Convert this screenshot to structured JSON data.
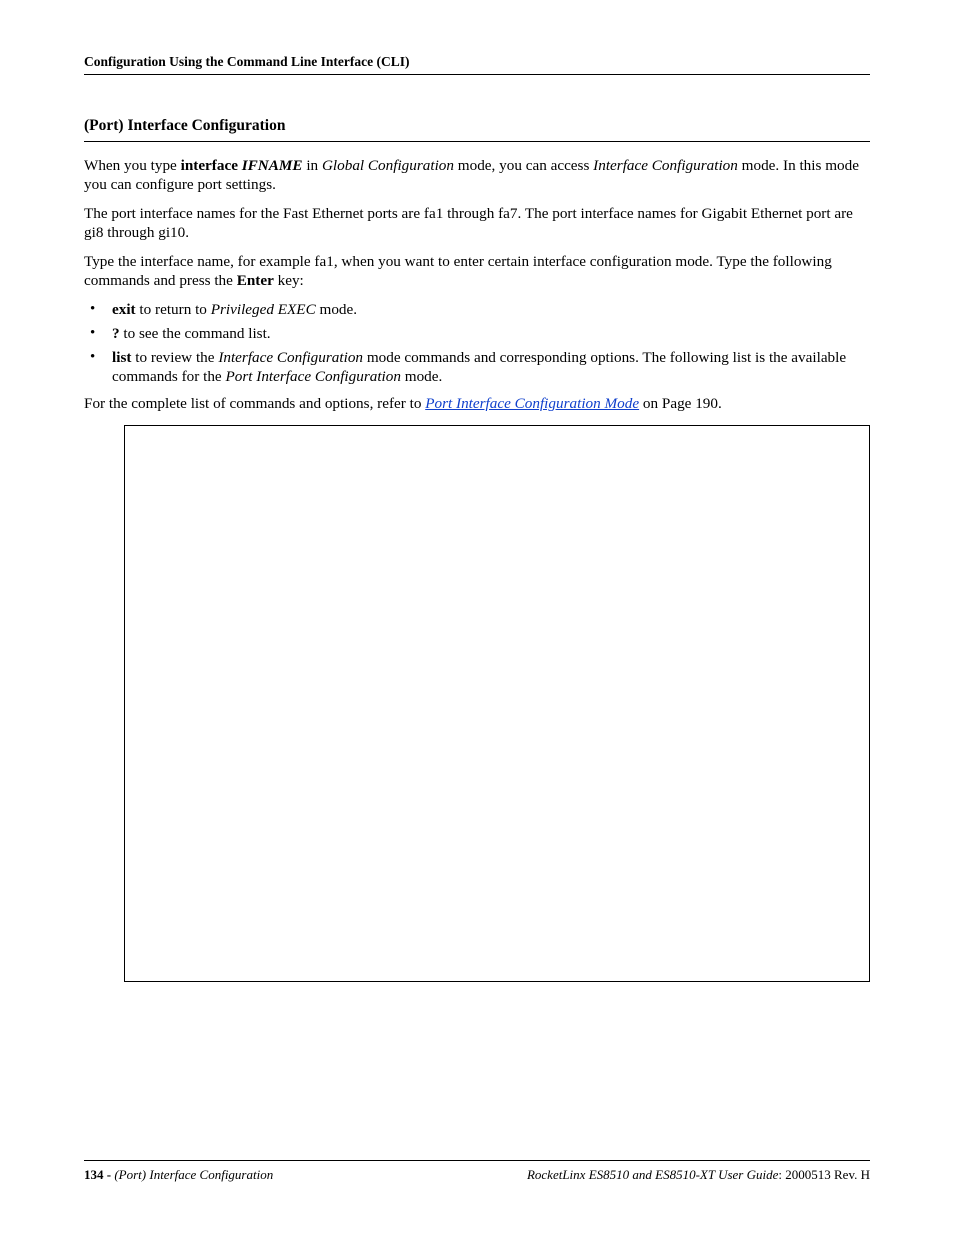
{
  "header": {
    "running": "Configuration Using the Command Line Interface (CLI)"
  },
  "section": {
    "title": "(Port) Interface Configuration"
  },
  "para1": {
    "t1": "When you type ",
    "cmd": "interface",
    "space": " ",
    "arg": "IFNAME",
    "t2": " in ",
    "mode1": "Global Configuration",
    "t3": " mode, you can access ",
    "mode2": "Interface Configuration",
    "t4": " mode. In this mode you can configure port settings."
  },
  "para2": "The port interface names for the Fast Ethernet ports are fa1 through fa7.  The port interface names for Gigabit Ethernet port are gi8 through gi10.",
  "para3": {
    "t1": "Type the interface name, for example fa1, when you want to enter certain interface configuration mode. Type the following commands and press the ",
    "key": "Enter",
    "t2": " key:"
  },
  "bullets": {
    "b1": {
      "cmd": "exit",
      "t1": " to return to ",
      "mode": "Privileged EXEC",
      "t2": " mode."
    },
    "b2": {
      "cmd": "?",
      "t1": " to see the command list."
    },
    "b3": {
      "cmd": "list",
      "t1": " to review the ",
      "mode1": "Interface Configuration",
      "t2": " mode commands and corresponding options. The following list is the available commands for the ",
      "mode2": "Port Interface Configuration",
      "t3": " mode."
    }
  },
  "para4": {
    "t1": "For the complete list of commands and options, refer to ",
    "link": "Port Interface Configuration Mode",
    "t2": " on Page 190."
  },
  "footer": {
    "pagenum": "134 - ",
    "section": "(Port) Interface Configuration",
    "guide": "RocketLinx ES8510  and ES8510-XT User Guide",
    "rev": ": 2000513 Rev. H"
  }
}
